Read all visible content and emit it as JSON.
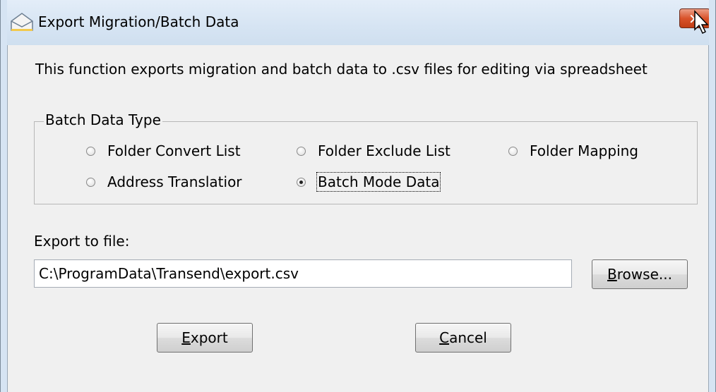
{
  "window": {
    "title": "Export Migration/Batch Data",
    "close_icon": "close-icon"
  },
  "description": "This function exports migration and  batch data to .csv files for editing via spreadsheet",
  "batch_group": {
    "legend": "Batch Data Type",
    "options": [
      {
        "label": "Folder Convert List",
        "checked": false
      },
      {
        "label": "Folder Exclude List",
        "checked": false
      },
      {
        "label": "Folder Mapping",
        "checked": false
      },
      {
        "label": "Address Translatior",
        "checked": false
      },
      {
        "label": "Batch Mode Data",
        "checked": true
      }
    ]
  },
  "export": {
    "label": "Export to file:",
    "path_value": "C:\\ProgramData\\Transend\\export.csv"
  },
  "buttons": {
    "browse": {
      "mnemonic": "B",
      "rest": "rowse..."
    },
    "export": {
      "mnemonic": "E",
      "rest": "xport"
    },
    "cancel": {
      "mnemonic": "C",
      "rest": "ancel"
    }
  },
  "colors": {
    "titlebar": "#d6e4f3",
    "close_button": "#d9532b",
    "background": "#f0f0f0"
  }
}
